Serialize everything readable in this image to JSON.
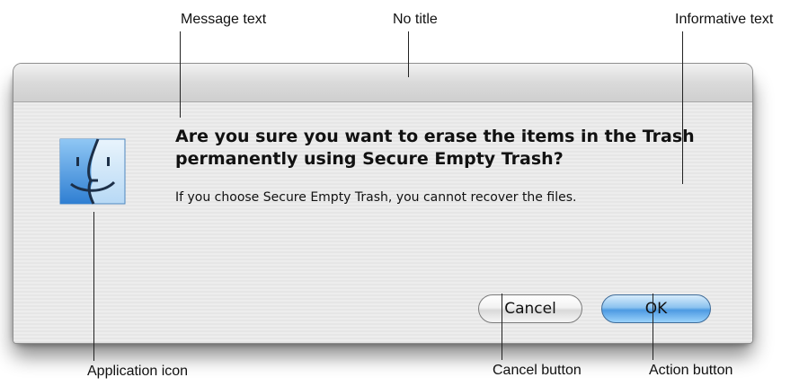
{
  "annotations": {
    "message_text": "Message text",
    "no_title": "No title",
    "informative_text": "Informative text",
    "application_icon": "Application icon",
    "cancel_button": "Cancel button",
    "action_button": "Action button"
  },
  "dialog": {
    "title": "",
    "icon": "finder-icon",
    "message": "Are you sure you want to erase the items in the Trash permanently using Secure Empty Trash?",
    "informative": "If you choose Secure Empty Trash, you cannot recover the files.",
    "cancel_label": "Cancel",
    "ok_label": "OK"
  },
  "colors": {
    "accent_button": "#5aa6ec",
    "finder_blue": "#3d8fdc"
  }
}
